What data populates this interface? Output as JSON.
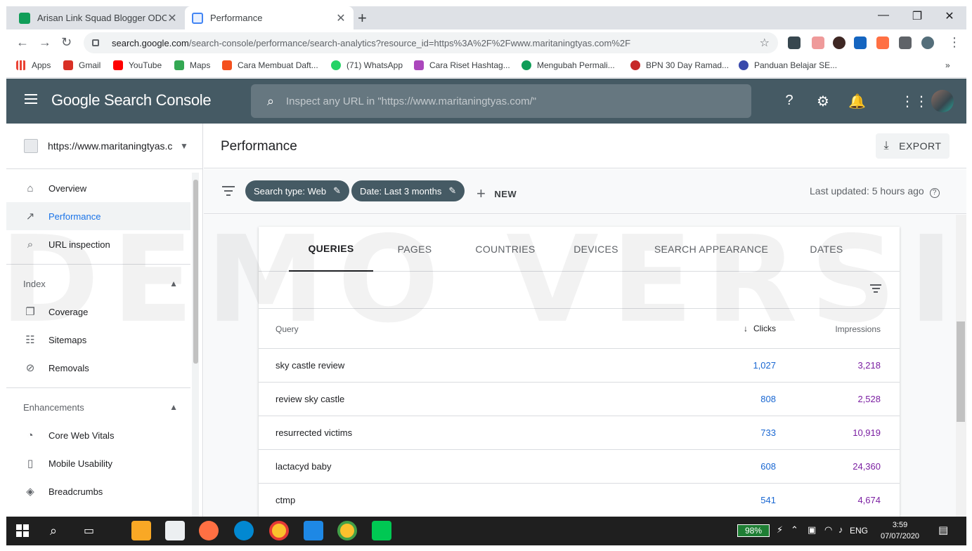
{
  "browser": {
    "tabs": [
      {
        "title": "Arisan Link Squad Blogger ODOP",
        "active": false
      },
      {
        "title": "Performance",
        "active": true
      }
    ],
    "new_tab": "+",
    "window_controls": {
      "minimize": "—",
      "maximize": "❐",
      "close": "✕"
    },
    "url_host": "search.google.com",
    "url_path": "/search-console/performance/search-analytics?resource_id=https%3A%2F%2Fwww.maritaningtyas.com%2F",
    "bookmarks": [
      {
        "label": "Apps",
        "color": "#ea4335"
      },
      {
        "label": "Gmail",
        "color": "#d93025"
      },
      {
        "label": "YouTube",
        "color": "#ff0000"
      },
      {
        "label": "Maps",
        "color": "#34a853"
      },
      {
        "label": "Cara Membuat Daft...",
        "color": "#f4511e"
      },
      {
        "label": "(71) WhatsApp",
        "color": "#25d366"
      },
      {
        "label": "Cara Riset Hashtag...",
        "color": "#ab47bc"
      },
      {
        "label": "Mengubah Permali...",
        "color": "#0f9d58"
      },
      {
        "label": "BPN 30 Day Ramad...",
        "color": "#c62828"
      },
      {
        "label": "Panduan Belajar SE...",
        "color": "#3949ab"
      }
    ],
    "bookmarks_overflow": "»"
  },
  "gsc": {
    "brand": "Google Search Console",
    "search_placeholder": "Inspect any URL in \"https://www.maritaningtyas.com/\"",
    "property": "https://www.maritaningtyas.c...",
    "nav": {
      "top": [
        {
          "label": "Overview",
          "icon": "home-icon",
          "active": false
        },
        {
          "label": "Performance",
          "icon": "trending-up-icon",
          "active": true
        },
        {
          "label": "URL inspection",
          "icon": "search-icon",
          "active": false
        }
      ],
      "index_title": "Index",
      "index": [
        {
          "label": "Coverage",
          "icon": "coverage-icon"
        },
        {
          "label": "Sitemaps",
          "icon": "sitemap-icon"
        },
        {
          "label": "Removals",
          "icon": "removals-icon"
        }
      ],
      "enh_title": "Enhancements",
      "enhancements": [
        {
          "label": "Core Web Vitals",
          "icon": "speed-icon"
        },
        {
          "label": "Mobile Usability",
          "icon": "phone-icon"
        },
        {
          "label": "Breadcrumbs",
          "icon": "layers-icon"
        }
      ]
    },
    "page_title": "Performance",
    "export_label": "EXPORT",
    "filters": [
      "Search type: Web",
      "Date: Last 3 months"
    ],
    "new_label": "NEW",
    "last_updated": "Last updated: 5 hours ago",
    "tabs": [
      "QUERIES",
      "PAGES",
      "COUNTRIES",
      "DEVICES",
      "SEARCH APPEARANCE",
      "DATES"
    ],
    "active_tab": "QUERIES",
    "table": {
      "headers": {
        "query": "Query",
        "clicks": "Clicks",
        "impressions": "Impressions"
      },
      "rows": [
        {
          "query": "sky castle review",
          "clicks": "1,027",
          "impressions": "3,218"
        },
        {
          "query": "review sky castle",
          "clicks": "808",
          "impressions": "2,528"
        },
        {
          "query": "resurrected victims",
          "clicks": "733",
          "impressions": "10,919"
        },
        {
          "query": "lactacyd baby",
          "clicks": "608",
          "impressions": "24,360"
        },
        {
          "query": "ctmp",
          "clicks": "541",
          "impressions": "4,674"
        }
      ]
    },
    "watermark": "DEMO VERSION"
  },
  "taskbar": {
    "battery": "98%",
    "lang": "ENG",
    "time": "3:59",
    "date": "07/07/2020"
  },
  "colors": {
    "header_bg": "#455a64",
    "clicks": "#1967d2",
    "impressions": "#7b1fa2",
    "active_nav": "#1a73e8"
  }
}
